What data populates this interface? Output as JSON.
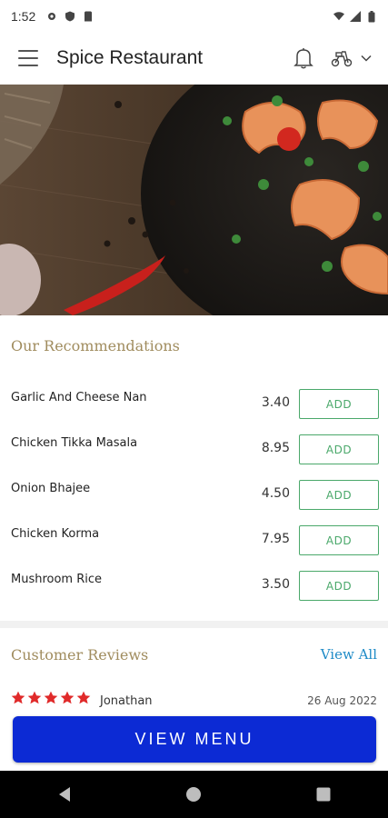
{
  "status_bar": {
    "time": "1:52"
  },
  "app_bar": {
    "title": "Spice Restaurant"
  },
  "recommendations": {
    "title": "Our Recommendations",
    "add_label": "ADD",
    "items": [
      {
        "name": "Garlic And Cheese Nan",
        "price": "3.40"
      },
      {
        "name": "Chicken Tikka Masala",
        "price": "8.95"
      },
      {
        "name": "Onion Bhajee",
        "price": "4.50"
      },
      {
        "name": "Chicken Korma",
        "price": "7.95"
      },
      {
        "name": "Mushroom Rice",
        "price": "3.50"
      }
    ]
  },
  "reviews": {
    "title": "Customer Reviews",
    "view_all": "View All",
    "items": [
      {
        "rating": 5,
        "reviewer": "Jonathan",
        "date": "26 Aug 2022"
      }
    ]
  },
  "cta": {
    "label": "VIEW MENU"
  },
  "colors": {
    "accent_gold": "#a08c5e",
    "add_green": "#4aa86a",
    "link_blue": "#1f8bc7",
    "cta_blue": "#0c2ad4",
    "star_red": "#e02a2a"
  }
}
